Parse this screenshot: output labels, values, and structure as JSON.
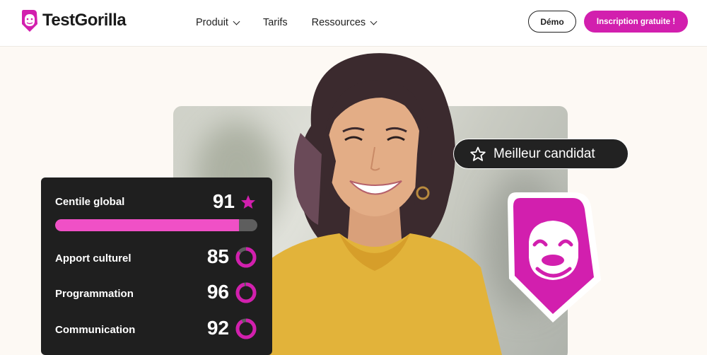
{
  "brand": {
    "name": "TestGorilla",
    "accent": "#d21fae"
  },
  "nav": {
    "items": [
      {
        "label": "Produit",
        "has_dropdown": true
      },
      {
        "label": "Tarifs",
        "has_dropdown": false
      },
      {
        "label": "Ressources",
        "has_dropdown": true
      }
    ],
    "demo_label": "Démo",
    "signup_label": "Inscription gratuite !"
  },
  "hero": {
    "badge_label": "Meilleur candidat",
    "badge_icon": "star-outline-icon"
  },
  "score_card": {
    "headline": {
      "label": "Centile global",
      "value": "91",
      "progress": 0.91,
      "icon": "star-icon"
    },
    "rows": [
      {
        "label": "Apport culturel",
        "value": "85",
        "percent": 85
      },
      {
        "label": "Programmation",
        "value": "96",
        "percent": 96
      },
      {
        "label": "Communication",
        "value": "92",
        "percent": 92
      }
    ]
  }
}
